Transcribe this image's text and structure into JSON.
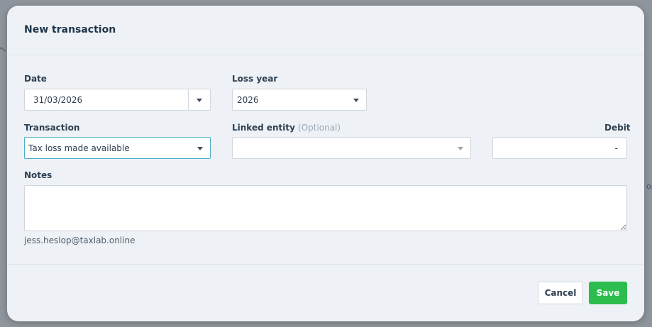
{
  "modal": {
    "title": "New transaction"
  },
  "form": {
    "date": {
      "label": "Date",
      "value": "31/03/2026"
    },
    "loss_year": {
      "label": "Loss year",
      "value": "2026"
    },
    "transaction": {
      "label": "Transaction",
      "value": "Tax loss made available"
    },
    "linked_entity": {
      "label": "Linked entity",
      "optional": "(Optional)",
      "value": ""
    },
    "debit": {
      "label": "Debit",
      "value": "-"
    },
    "notes": {
      "label": "Notes",
      "value": ""
    }
  },
  "user_email": "jess.heslop@taxlab.online",
  "footer": {
    "cancel_label": "Cancel",
    "save_label": "Save"
  },
  "backdrop": {
    "edge_text": "op"
  },
  "colors": {
    "accent_focus": "#4bb0c7",
    "save_green": "#2dbd4e",
    "modal_bg": "#eef2f6"
  }
}
